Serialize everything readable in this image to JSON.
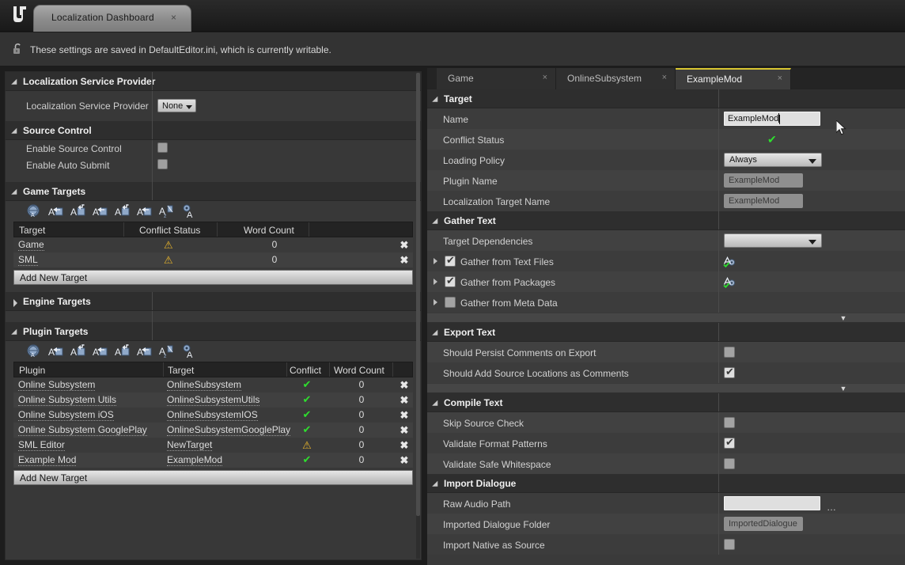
{
  "window": {
    "app_tab_label": "Localization Dashboard",
    "app_tab_close": "×",
    "logo_glyph": "℩"
  },
  "notice": {
    "text": "These settings are saved in DefaultEditor.ini, which is currently writable.",
    "icon": "unlock-icon"
  },
  "colors": {
    "accent_yellow": "#d8c531",
    "status_ok": "#2ee02e",
    "status_warning": "#e9b52b",
    "panel_bg": "#383838",
    "section_bg": "#2e2e2e"
  },
  "left_panel": {
    "sections": [
      {
        "title": "Localization Service Provider",
        "expanded": true,
        "rows": [
          {
            "label": "Localization Service Provider",
            "type": "combo",
            "value": "None"
          }
        ]
      },
      {
        "title": "Source Control",
        "expanded": true,
        "rows": [
          {
            "label": "Enable Source Control",
            "type": "checkbox",
            "checked": false
          },
          {
            "label": "Enable Auto Submit",
            "type": "checkbox",
            "checked": false
          }
        ]
      }
    ],
    "game_targets": {
      "title": "Game Targets",
      "expanded": true,
      "toolbar_icons": [
        "gather-all-text-icon",
        "gather-text-icon",
        "export-text-icon",
        "import-text-icon",
        "export-dialogue-icon",
        "import-dialogue-icon",
        "compile-text-icon",
        "settings-text-icon"
      ],
      "columns": [
        "Target",
        "Conflict Status",
        "Word Count",
        ""
      ],
      "rows": [
        {
          "target": "Game",
          "conflict": "warning",
          "word_count": "0",
          "delete": "✖"
        },
        {
          "target": "SML",
          "conflict": "warning",
          "word_count": "0",
          "delete": "✖"
        }
      ],
      "add_button": "Add New Target"
    },
    "engine_targets": {
      "title": "Engine Targets",
      "expanded": false
    },
    "plugin_targets": {
      "title": "Plugin Targets",
      "expanded": true,
      "toolbar_icons": [
        "gather-all-text-icon",
        "gather-text-icon",
        "export-text-icon",
        "import-text-icon",
        "export-dialogue-icon",
        "import-dialogue-icon",
        "compile-text-icon",
        "settings-text-icon"
      ],
      "columns": [
        "Plugin",
        "Target",
        "Conflict",
        "Word Count",
        ""
      ],
      "rows": [
        {
          "plugin": "Online Subsystem",
          "target": "OnlineSubsystem",
          "conflict": "ok",
          "word_count": "0",
          "delete": "✖"
        },
        {
          "plugin": "Online Subsystem Utils",
          "target": "OnlineSubsystemUtils",
          "conflict": "ok",
          "word_count": "0",
          "delete": "✖"
        },
        {
          "plugin": "Online Subsystem iOS",
          "target": "OnlineSubsystemIOS",
          "conflict": "ok",
          "word_count": "0",
          "delete": "✖"
        },
        {
          "plugin": "Online Subsystem GooglePlay",
          "target": "OnlineSubsystemGooglePlay",
          "conflict": "ok",
          "word_count": "0",
          "delete": "✖"
        },
        {
          "plugin": "SML Editor",
          "target": "NewTarget",
          "conflict": "warning",
          "word_count": "0",
          "delete": "✖"
        },
        {
          "plugin": "Example Mod",
          "target": "ExampleMod",
          "conflict": "ok",
          "word_count": "0",
          "delete": "✖"
        }
      ],
      "add_button": "Add New Target"
    }
  },
  "right_panel": {
    "tabs": [
      {
        "label": "Game",
        "active": false,
        "close": "×"
      },
      {
        "label": "OnlineSubsystem",
        "active": false,
        "close": "×"
      },
      {
        "label": "ExampleMod",
        "active": true,
        "close": "×"
      }
    ],
    "sections": [
      {
        "title": "Target",
        "rows": [
          {
            "label": "Name",
            "type": "text",
            "value": "ExampleMod",
            "focused": true
          },
          {
            "label": "Conflict Status",
            "type": "status",
            "value": "ok"
          },
          {
            "label": "Loading Policy",
            "type": "combo",
            "value": "Always"
          },
          {
            "label": "Plugin Name",
            "type": "readonly",
            "value": "ExampleMod"
          },
          {
            "label": "Localization Target Name",
            "type": "readonly",
            "value": "ExampleMod"
          }
        ]
      },
      {
        "title": "Gather Text",
        "rows": [
          {
            "label": "Target Dependencies",
            "type": "combo",
            "value": ""
          },
          {
            "label": "Gather from Text Files",
            "type": "tree-checkbox",
            "checked": true,
            "action_icon": "gather-settings-icon"
          },
          {
            "label": "Gather from Packages",
            "type": "tree-checkbox",
            "checked": true,
            "action_icon": "gather-settings-icon"
          },
          {
            "label": "Gather from Meta Data",
            "type": "tree-checkbox",
            "checked": false
          }
        ],
        "has_expander": true
      },
      {
        "title": "Export Text",
        "rows": [
          {
            "label": "Should Persist Comments on Export",
            "type": "checkbox",
            "checked": false
          },
          {
            "label": "Should Add Source Locations as Comments",
            "type": "checkbox",
            "checked": true
          }
        ],
        "has_expander": true
      },
      {
        "title": "Compile Text",
        "rows": [
          {
            "label": "Skip Source Check",
            "type": "checkbox",
            "checked": false
          },
          {
            "label": "Validate Format Patterns",
            "type": "checkbox",
            "checked": true
          },
          {
            "label": "Validate Safe Whitespace",
            "type": "checkbox",
            "checked": false
          }
        ]
      },
      {
        "title": "Import Dialogue",
        "rows": [
          {
            "label": "Raw Audio Path",
            "type": "path",
            "value": "",
            "browse": "…"
          },
          {
            "label": "Imported Dialogue Folder",
            "type": "readonly",
            "value": "ImportedDialogue"
          },
          {
            "label": "Import Native as Source",
            "type": "checkbox",
            "checked": false
          }
        ]
      }
    ]
  }
}
